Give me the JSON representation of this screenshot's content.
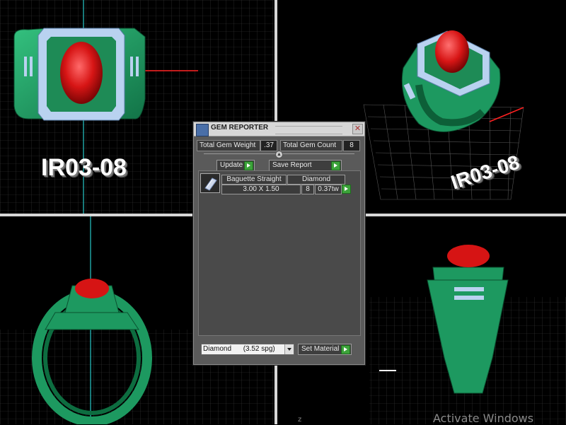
{
  "viewports": {
    "top_left_label": "IR03-08",
    "top_right_label": "IR03-08"
  },
  "watermark": "Activate Windows",
  "corner_mark": "z",
  "dialog": {
    "title": "GEM REPORTER",
    "total_gem_weight_label": "Total Gem Weight",
    "total_gem_weight_value": ".37",
    "total_gem_count_label": "Total Gem Count",
    "total_gem_count_value": "8",
    "update_label": "Update",
    "save_report_label": "Save Report",
    "gems": [
      {
        "shape": "Baguette Straight",
        "material": "Diamond",
        "size": "3.00 X 1.50",
        "count": "8",
        "weight": "0.37tw"
      }
    ],
    "material_select": "Diamond      (3.52 spg)",
    "set_material_label": "Set Material"
  },
  "colors": {
    "metal": "#1f9a62",
    "gem": "#d61414",
    "diamond_accent": "#b9d2f0",
    "axis_red": "#ff2020",
    "axis_cyan": "#27c9c9"
  }
}
